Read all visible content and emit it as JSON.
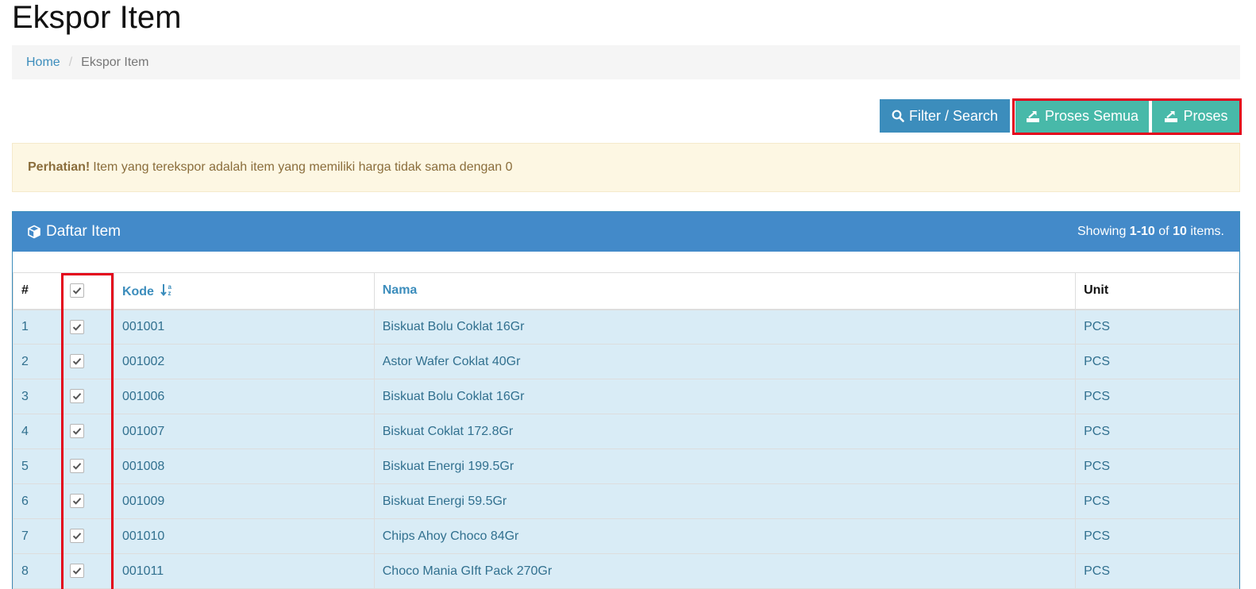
{
  "page": {
    "title": "Ekspor Item"
  },
  "breadcrumb": {
    "home": "Home",
    "separator": "/",
    "current": "Ekspor Item"
  },
  "toolbar": {
    "filter_label": "Filter / Search",
    "proses_semua_label": "Proses Semua",
    "proses_label": "Proses"
  },
  "alert": {
    "strong": "Perhatian!",
    "message": "Item yang terekspor adalah item yang memiliki harga tidak sama dengan 0"
  },
  "panel": {
    "title": "Daftar Item",
    "summary_prefix": "Showing",
    "summary_range": "1-10",
    "summary_of": "of",
    "summary_total": "10",
    "summary_suffix": "items."
  },
  "table": {
    "headers": {
      "num": "#",
      "kode": "Kode",
      "nama": "Nama",
      "unit": "Unit"
    },
    "header_checked": true,
    "rows": [
      {
        "num": "1",
        "checked": true,
        "kode": "001001",
        "nama": "Biskuat Bolu Coklat 16Gr",
        "unit": "PCS"
      },
      {
        "num": "2",
        "checked": true,
        "kode": "001002",
        "nama": "Astor Wafer Coklat 40Gr",
        "unit": "PCS"
      },
      {
        "num": "3",
        "checked": true,
        "kode": "001006",
        "nama": "Biskuat Bolu Coklat 16Gr",
        "unit": "PCS"
      },
      {
        "num": "4",
        "checked": true,
        "kode": "001007",
        "nama": "Biskuat Coklat 172.8Gr",
        "unit": "PCS"
      },
      {
        "num": "5",
        "checked": true,
        "kode": "001008",
        "nama": "Biskuat Energi 199.5Gr",
        "unit": "PCS"
      },
      {
        "num": "6",
        "checked": true,
        "kode": "001009",
        "nama": "Biskuat Energi 59.5Gr",
        "unit": "PCS"
      },
      {
        "num": "7",
        "checked": true,
        "kode": "001010",
        "nama": "Chips Ahoy Choco 84Gr",
        "unit": "PCS"
      },
      {
        "num": "8",
        "checked": true,
        "kode": "001011",
        "nama": "Choco Mania GIft Pack 270Gr",
        "unit": "PCS"
      }
    ]
  },
  "colors": {
    "primary": "#3c8dbc",
    "panel_heading": "#438ac9",
    "success": "#48b9a9",
    "alert_bg": "#fdf7e3",
    "row_bg": "#d9ecf6",
    "highlight": "#e3001b"
  },
  "icons": {
    "filter": "search-icon",
    "proses_semua": "export-icon",
    "proses": "export-icon",
    "panel": "cube-icon",
    "sort": "sort-alpha-icon",
    "checkbox": "check-icon"
  }
}
